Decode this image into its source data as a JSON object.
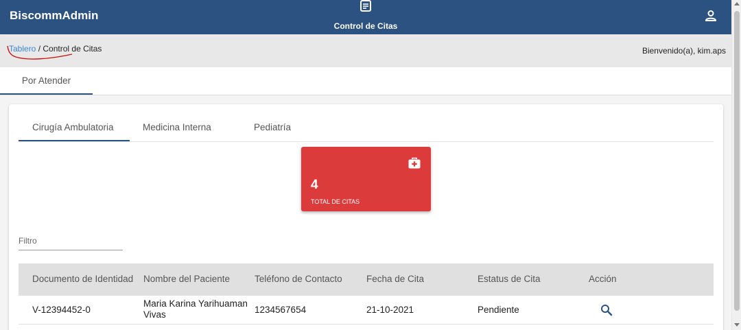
{
  "header": {
    "brand": "BiscommAdmin",
    "section_title": "Control de Citas",
    "section_icon": "document-icon",
    "user_icon": "user-icon",
    "bg_color": "#2c5282"
  },
  "subbar": {
    "breadcrumb_link": "Tablero",
    "breadcrumb_separator": " / ",
    "breadcrumb_current": "Control de Citas",
    "welcome": "Bienvenido(a), kim.aps"
  },
  "top_tabs": [
    {
      "label": "Por Atender",
      "active": true
    }
  ],
  "inner_tabs": [
    {
      "label": "Cirugía Ambulatoria",
      "active": true
    },
    {
      "label": "Medicina Interna",
      "active": false
    },
    {
      "label": "Pediatría",
      "active": false
    }
  ],
  "stat_card": {
    "value": "4",
    "label": "TOTAL DE CITAS",
    "icon": "medical-kit-icon",
    "color": "#dc3b3b"
  },
  "filter": {
    "placeholder": "Filtro",
    "value": ""
  },
  "table": {
    "columns": [
      "Documento de Identidad",
      "Nombre del Paciente",
      "Teléfono de Contacto",
      "Fecha de Cita",
      "Estatus de Cita",
      "Acción"
    ],
    "rows": [
      {
        "documento": "V-12394452-0",
        "nombre": "Maria Karina Yarihuaman Vivas",
        "telefono": "1234567654",
        "fecha": "21-10-2021",
        "estatus": "Pendiente",
        "accion_icon": "search-icon"
      }
    ]
  }
}
